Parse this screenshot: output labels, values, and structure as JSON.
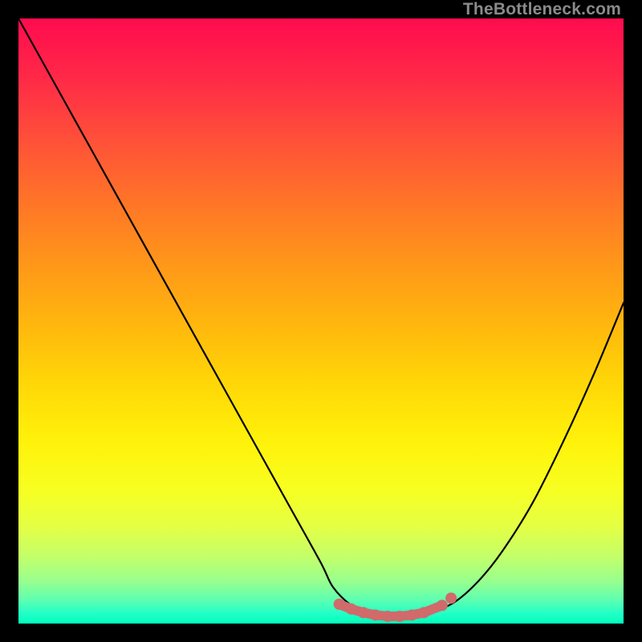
{
  "watermark": "TheBottleneck.com",
  "chart_data": {
    "type": "line",
    "title": "",
    "xlabel": "",
    "ylabel": "",
    "xlim": [
      0,
      100
    ],
    "ylim": [
      0,
      100
    ],
    "grid": false,
    "legend": false,
    "line_color": "#000000",
    "marker_color": "#d16a6a",
    "gradient_background": [
      "#ff0b4f",
      "#ff951a",
      "#fff20a",
      "#00ffb9"
    ],
    "series": [
      {
        "name": "bottleneck-curve",
        "x": [
          0,
          5,
          10,
          15,
          20,
          25,
          30,
          35,
          40,
          45,
          50,
          52,
          55,
          58,
          60,
          63,
          65,
          68,
          72,
          76,
          80,
          85,
          90,
          95,
          100
        ],
        "y": [
          100,
          91,
          82,
          73,
          64,
          55,
          46,
          37,
          28,
          19,
          10,
          6,
          3,
          1.5,
          1,
          1,
          1.2,
          1.8,
          3.5,
          7,
          12,
          20,
          30,
          41,
          53
        ]
      }
    ],
    "markers": {
      "name": "highlight-points",
      "x": [
        53,
        55,
        57,
        59,
        61,
        63,
        65,
        67,
        70
      ],
      "y": [
        3.2,
        2.4,
        1.8,
        1.4,
        1.2,
        1.2,
        1.4,
        1.8,
        3.0
      ]
    }
  }
}
